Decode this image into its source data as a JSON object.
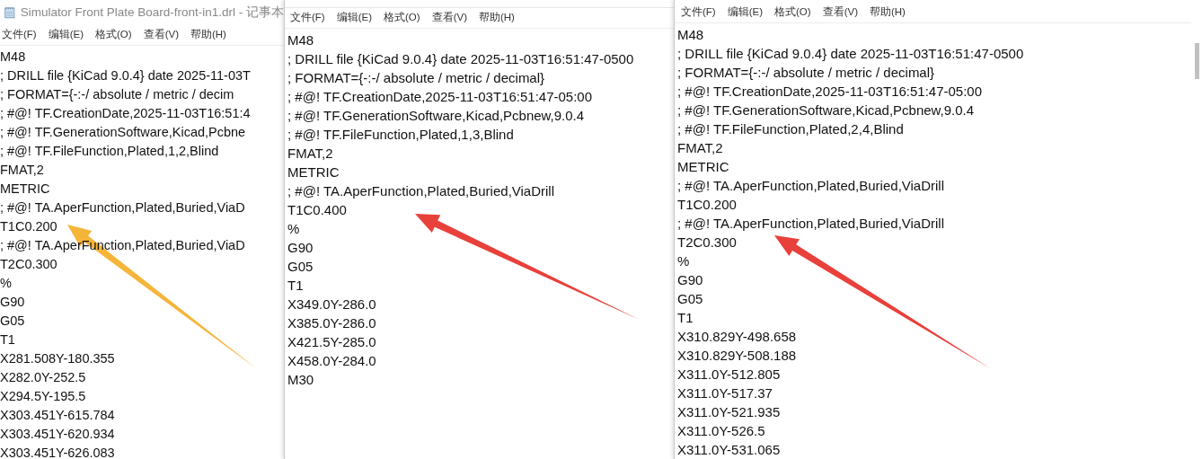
{
  "windows": [
    {
      "title": "Simulator Front Plate Board-front-in1.drl - 记事本",
      "menu": [
        "文件(F)",
        "编辑(E)",
        "格式(O)",
        "查看(V)",
        "帮助(H)"
      ],
      "lines": [
        "M48",
        "; DRILL file {KiCad 9.0.4} date 2025-11-03T",
        "; FORMAT={-:-/ absolute / metric / decim",
        "; #@! TF.CreationDate,2025-11-03T16:51:4",
        "; #@! TF.GenerationSoftware,Kicad,Pcbne",
        "; #@! TF.FileFunction,Plated,1,2,Blind",
        "FMAT,2",
        "METRIC",
        "; #@! TA.AperFunction,Plated,Buried,ViaD",
        "T1C0.200",
        "; #@! TA.AperFunction,Plated,Buried,ViaD",
        "T2C0.300",
        "%",
        "G90",
        "G05",
        "T1",
        "X281.508Y-180.355",
        "X282.0Y-252.5",
        "X294.5Y-195.5",
        "X303.451Y-615.784",
        "X303.451Y-620.934",
        "X303.451Y-626.083"
      ]
    },
    {
      "menu": [
        "文件(F)",
        "编辑(E)",
        "格式(O)",
        "查看(V)",
        "帮助(H)"
      ],
      "lines": [
        "M48",
        "; DRILL file {KiCad 9.0.4} date 2025-11-03T16:51:47-0500",
        "; FORMAT={-:-/ absolute / metric / decimal}",
        "; #@! TF.CreationDate,2025-11-03T16:51:47-05:00",
        "; #@! TF.GenerationSoftware,Kicad,Pcbnew,9.0.4",
        "; #@! TF.FileFunction,Plated,1,3,Blind",
        "FMAT,2",
        "METRIC",
        "; #@! TA.AperFunction,Plated,Buried,ViaDrill",
        "T1C0.400",
        "%",
        "G90",
        "G05",
        "T1",
        "X349.0Y-286.0",
        "X385.0Y-286.0",
        "X421.5Y-285.0",
        "X458.0Y-284.0",
        "M30"
      ]
    },
    {
      "menu": [
        "文件(F)",
        "编辑(E)",
        "格式(O)",
        "查看(V)",
        "帮助(H)"
      ],
      "lines": [
        "M48",
        "; DRILL file {KiCad 9.0.4} date 2025-11-03T16:51:47-0500",
        "; FORMAT={-:-/ absolute / metric / decimal}",
        "; #@! TF.CreationDate,2025-11-03T16:51:47-05:00",
        "; #@! TF.GenerationSoftware,Kicad,Pcbnew,9.0.4",
        "; #@! TF.FileFunction,Plated,2,4,Blind",
        "FMAT,2",
        "METRIC",
        "; #@! TA.AperFunction,Plated,Buried,ViaDrill",
        "T1C0.200",
        "; #@! TA.AperFunction,Plated,Buried,ViaDrill",
        "T2C0.300",
        "%",
        "G90",
        "G05",
        "T1",
        "X310.829Y-498.658",
        "X310.829Y-508.188",
        "X311.0Y-512.805",
        "X311.0Y-517.37",
        "X311.0Y-521.935",
        "X311.0Y-526.5",
        "X311.0Y-531.065"
      ]
    }
  ],
  "annotations": [
    {
      "kind": "arrow",
      "color": "#f5b53a"
    },
    {
      "kind": "arrow",
      "color": "#e8403a"
    },
    {
      "kind": "arrow",
      "color": "#e8403a"
    }
  ]
}
